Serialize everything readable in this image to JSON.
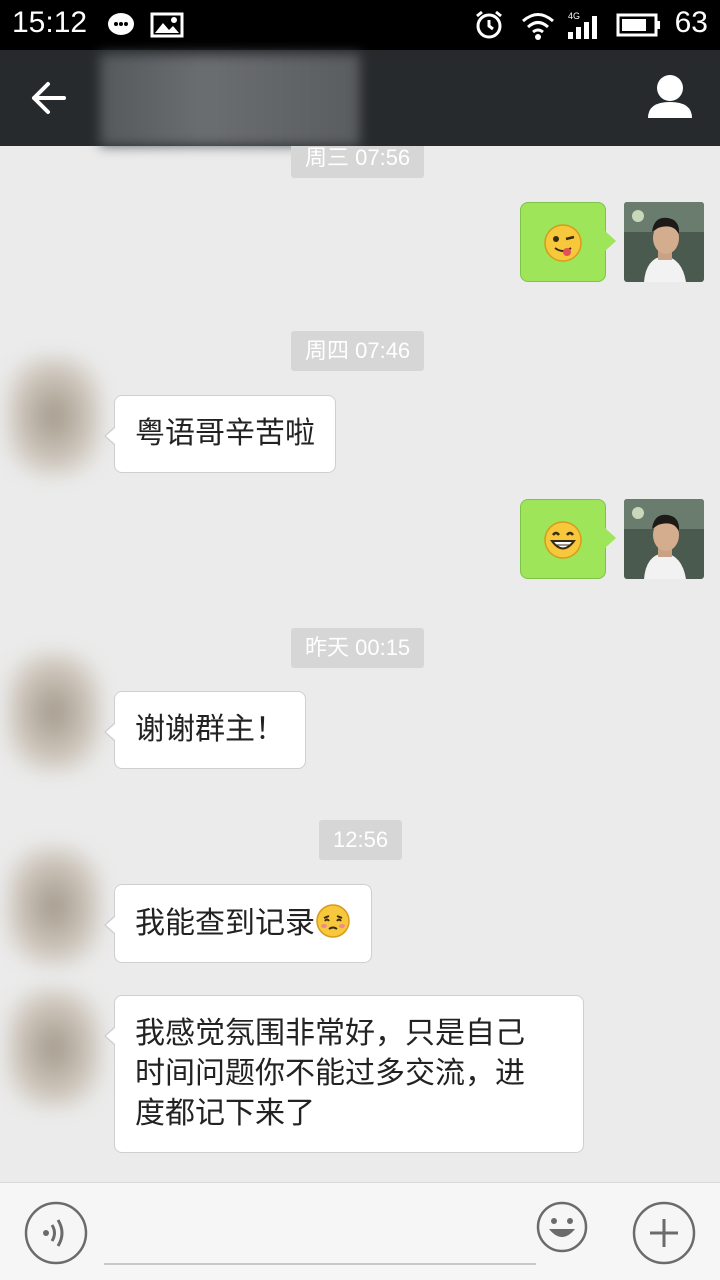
{
  "status_bar": {
    "time": "15:12",
    "battery_pct": "63",
    "network": "4G"
  },
  "header": {
    "title": "",
    "back_icon": "arrow-left-icon",
    "contact_icon": "person-icon"
  },
  "messages": [
    {
      "timestamp": "周三 07:56"
    },
    {
      "timestamp": "周四 07:46"
    },
    {
      "text": "粤语哥辛苦啦"
    },
    {
      "timestamp": "昨天 00:15"
    },
    {
      "text": "谢谢群主！"
    },
    {
      "timestamp": "12:56"
    },
    {
      "text": "我能查到记录"
    },
    {
      "text_lines": [
        "我感觉氛围非常好，只是自己",
        "时间问题你不能过多交流，进",
        "度都记下来了"
      ]
    }
  ],
  "input_bar": {
    "placeholder": "",
    "voice_icon": "voice-icon",
    "emoji_icon": "smiley-icon",
    "plus_icon": "plus-icon"
  },
  "colors": {
    "header_bg": "#262a2d",
    "chat_bg": "#ebebeb",
    "my_bubble": "#9ee559",
    "their_bubble": "#ffffff"
  }
}
